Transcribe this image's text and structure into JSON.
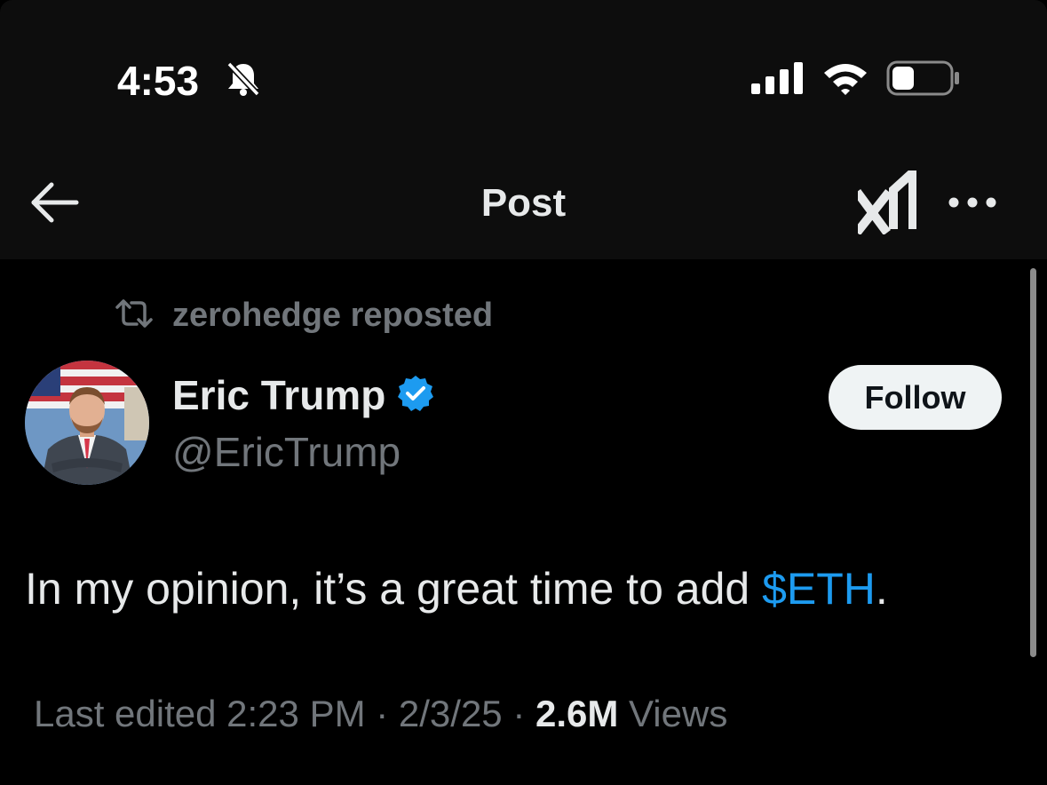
{
  "status_bar": {
    "time": "4:53",
    "icons": [
      "bell-slash-icon",
      "cellular-signal-icon",
      "wifi-icon",
      "battery-icon"
    ]
  },
  "header": {
    "title": "Post",
    "back_icon": "arrow-left-icon",
    "grok_icon": "grok-icon",
    "more_icon": "more-horizontal-icon"
  },
  "repost": {
    "icon": "repost-icon",
    "text": "zerohedge reposted"
  },
  "author": {
    "name": "Eric Trump",
    "handle": "@EricTrump",
    "verified_icon": "verified-badge-icon",
    "avatar_icon": "avatar"
  },
  "follow_button": {
    "label": "Follow"
  },
  "post": {
    "text_before": "In my opinion, it’s a great time to add ",
    "cashtag": "$ETH",
    "text_after": "."
  },
  "meta": {
    "edited": "Last edited 2:23 PM · 2/3/25",
    "separator": " · ",
    "views_count": "2.6M",
    "views_label": " Views"
  },
  "colors": {
    "background": "#000000",
    "header_background": "#0d0d0d",
    "text_primary": "#e7e9ea",
    "text_secondary": "#71767b",
    "accent": "#1d9bf0",
    "follow_bg": "#eff3f4"
  }
}
